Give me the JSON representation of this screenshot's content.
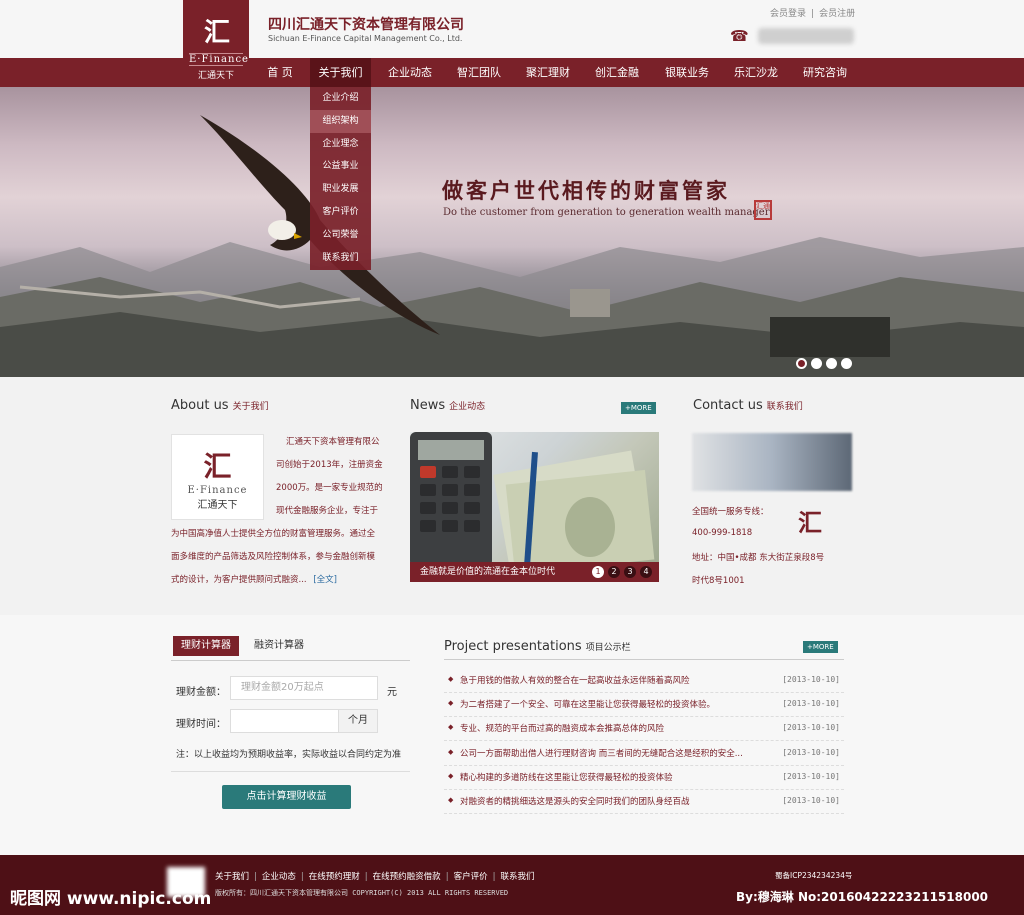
{
  "header": {
    "logo_mark": "汇",
    "logo_en": "E·Finance",
    "logo_cn": "汇通天下",
    "company_cn": "四川汇通天下资本管理有限公司",
    "company_en": "Sichuan E-Finance Capital Management Co., Ltd.",
    "login": "会员登录",
    "register": "会员注册",
    "phone_icon": "☎",
    "phone_number": "400-999-1818"
  },
  "nav": {
    "items": [
      "首 页",
      "关于我们",
      "企业动态",
      "智汇团队",
      "聚汇理财",
      "创汇金融",
      "银联业务",
      "乐汇沙龙",
      "研究咨询"
    ],
    "dropdown": [
      "企业介绍",
      "组织架构",
      "企业理念",
      "公益事业",
      "职业发展",
      "客户评价",
      "公司荣誉",
      "联系我们"
    ]
  },
  "banner": {
    "slogan_cn": "做客户世代相传的财富管家",
    "slogan_en": "Do the customer from generation to generation wealth manager",
    "seal_text": "汇通"
  },
  "about": {
    "title": "About us",
    "subtitle": "关于我们",
    "logo_mark": "汇",
    "logo_en": "E·Finance",
    "logo_cn": "汇通天下",
    "lines": [
      "汇通天下资本管理有限公",
      "司创始于2013年，注册资金",
      "2000万。是一家专业规范的",
      "现代金融服务企业，专注于",
      "为中国高净值人士提供全方位的财富管理服务。通过全",
      "面多维度的产品筛选及风险控制体系，参与金融创新模",
      "式的设计，为客户提供顾问式融资..."
    ],
    "more": "[全文]"
  },
  "news": {
    "title": "News",
    "subtitle": "企业动态",
    "more": "+MORE",
    "caption": "金融就是价值的流通在金本位时代",
    "dots": [
      "1",
      "2",
      "3",
      "4"
    ]
  },
  "contact": {
    "title": "Contact us",
    "subtitle": "联系我们",
    "hotline_label": "全国统一服务专线：",
    "hotline": "400-999-1818",
    "address_1": "地址：中国•成都 东大街芷泉段8号",
    "address_2": "时代8号1001",
    "logo_mark": "汇"
  },
  "calculator": {
    "tab_active": "理财计算器",
    "tab_other": "融资计算器",
    "amount_label": "理财金额：",
    "amount_placeholder": "理财金额20万起点",
    "amount_unit": "元",
    "time_label": "理财时间：",
    "time_unit": "个月",
    "note": "注：以上收益均为预期收益率，实际收益以合同约定为准",
    "button": "点击计算理财收益"
  },
  "projects": {
    "title": "Project presentations",
    "subtitle": "项目公示栏",
    "more": "+MORE",
    "rows": [
      {
        "text": "急于用钱的借款人有效的整合在一起高收益永远伴随着高风险",
        "date": "[2013-10-10]"
      },
      {
        "text": "为二者搭建了一个安全、可靠在这里能让您获得最轻松的投资体验。",
        "date": "[2013-10-10]"
      },
      {
        "text": "专业、规范的平台而过高的融资成本会推高总体的风险",
        "date": "[2013-10-10]"
      },
      {
        "text": "公司一方面帮助出借人进行理财咨询 而三者间的无缝配合这是经积的安全...",
        "date": "[2013-10-10]"
      },
      {
        "text": "精心构建的多道防线在这里能让您获得最轻松的投资体验",
        "date": "[2013-10-10]"
      },
      {
        "text": "对融资者的精挑细选这是源头的安全同时我们的团队身经百战",
        "date": "[2013-10-10]"
      }
    ]
  },
  "footer": {
    "links": [
      "关于我们",
      "企业动态",
      "在线预约理财",
      "在线预约融资借款",
      "客户评价",
      "联系我们"
    ],
    "copyright": "版权所有：四川汇通天下资本管理有限公司 COPYRIGHT(C) 2013 ALL RIGHTS RESERVED",
    "icp": "蜀备ICP234234234号"
  },
  "watermark": {
    "left": "昵图网 www.nipic.com",
    "right": "By:穆海琳 No:20160422223211518000"
  },
  "colors": {
    "brand": "#7a2129",
    "accent": "#2a7a7a",
    "footer": "#4e1016"
  }
}
